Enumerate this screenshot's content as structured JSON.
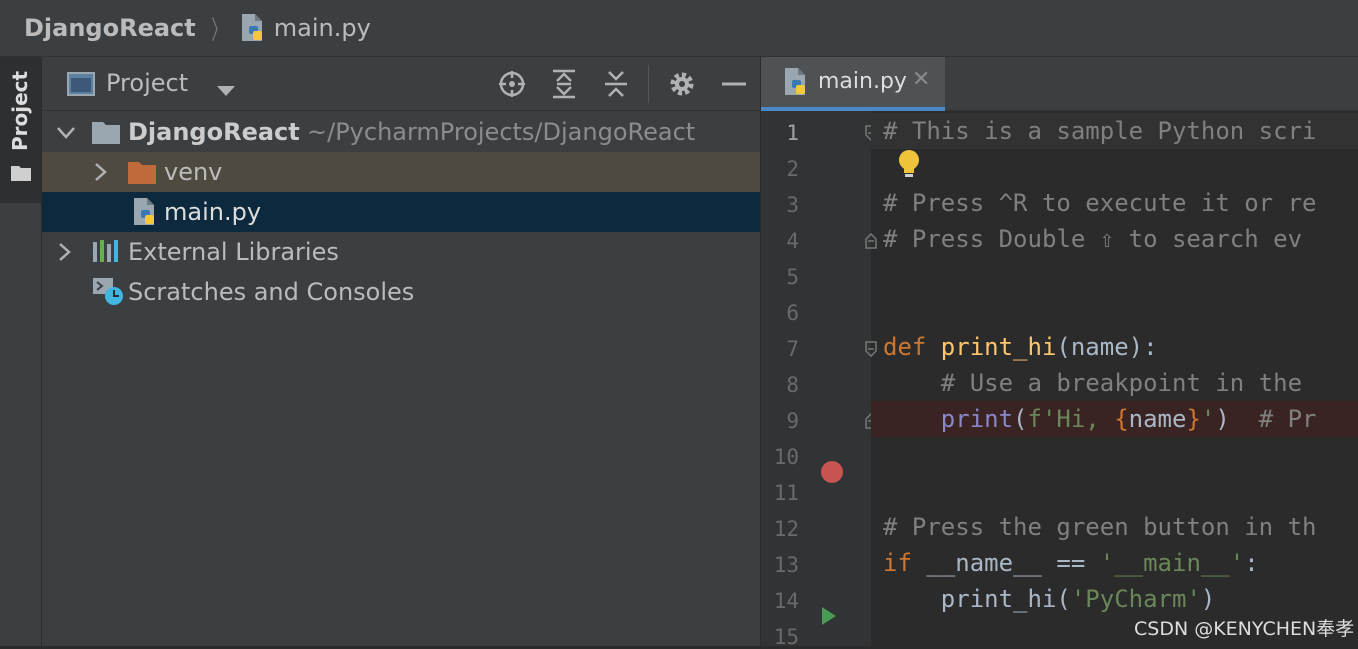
{
  "breadcrumb": {
    "project": "DjangoReact",
    "file": "main.py"
  },
  "tool_stripe": {
    "label": "Project"
  },
  "project_panel": {
    "title": "Project",
    "tree": {
      "root_name": "DjangoReact",
      "root_path": "~/PycharmProjects/DjangoReact",
      "venv": "venv",
      "main_file": "main.py",
      "external_libraries": "External Libraries",
      "scratches": "Scratches and Consoles"
    }
  },
  "editor": {
    "tab_label": "main.py",
    "close_glyph": "✕",
    "line_numbers": [
      "1",
      "2",
      "3",
      "4",
      "5",
      "6",
      "7",
      "8",
      "9",
      "10",
      "11",
      "12",
      "13",
      "14",
      "15"
    ],
    "code": {
      "l1": "# This is a sample Python scri",
      "l3": "# Press ^R to execute it or re",
      "l4": "# Press Double ⇧ to search ev",
      "l7_kw": "def ",
      "l7_fn": "print_hi",
      "l7_rest": "(name):",
      "l8": "    # Use a breakpoint in the",
      "l9_indent": "    ",
      "l9_fn": "print",
      "l9_p1": "(",
      "l9_str1": "f'Hi, ",
      "l9_brace1": "{",
      "l9_var": "name",
      "l9_brace2": "}",
      "l9_str2": "'",
      "l9_p2": ")",
      "l9_cmt": "  # Pr",
      "l12": "# Press the green button in th",
      "l13_kw": "if ",
      "l13_mid": "__name__ == ",
      "l13_str": "'__main__'",
      "l13_end": ":",
      "l14_a": "    print_hi(",
      "l14_str": "'PyCharm'",
      "l14_b": ")"
    }
  },
  "watermark": "CSDN @KENYCHEN奉孝",
  "colors": {
    "selection": "#0d293e",
    "venv_row": "#4e4a40",
    "breakpoint_line": "#3a2323",
    "breakpoint_dot": "#c75450",
    "run_arrow": "#499c54",
    "tab_underline": "#4a88c7",
    "lightbulb": "#f0c33c"
  },
  "icons": [
    "project-view-icon",
    "dropdown-arrow-icon",
    "locate-icon",
    "expand-all-icon",
    "collapse-all-icon",
    "gear-icon",
    "minimize-icon",
    "folder-icon",
    "python-file-icon",
    "library-icon",
    "scratches-icon",
    "chevron-down-icon",
    "chevron-right-icon",
    "lightbulb-icon",
    "breakpoint-icon",
    "run-icon",
    "fold-icon",
    "close-icon"
  ]
}
